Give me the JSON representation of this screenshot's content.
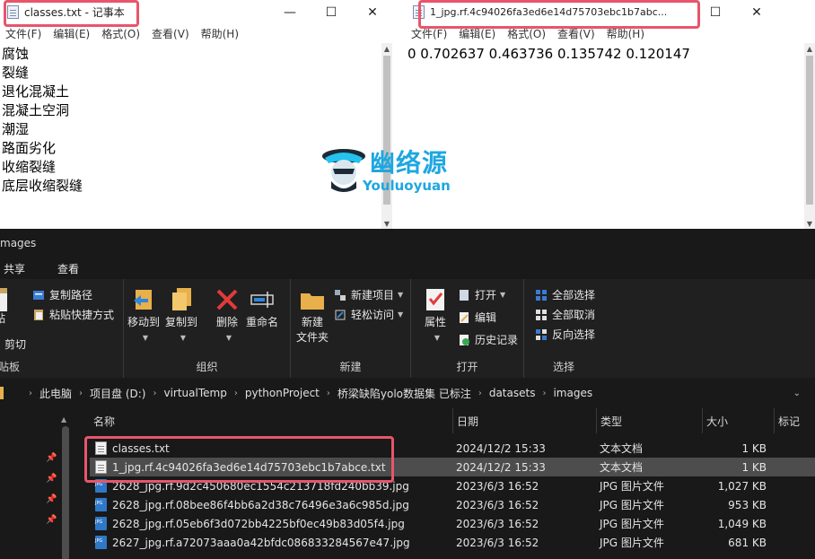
{
  "left_notepad": {
    "title": "classes.txt - 记事本",
    "menu": [
      "文件(F)",
      "编辑(E)",
      "格式(O)",
      "查看(V)",
      "帮助(H)"
    ],
    "lines": [
      "腐蚀",
      "裂缝",
      "退化混凝土",
      "混凝土空洞",
      "潮湿",
      "路面劣化",
      "收缩裂缝",
      "底层收缩裂缝"
    ]
  },
  "right_notepad": {
    "title": "1_jpg.rf.4c94026fa3ed6e14d75703ebc1b7abc...",
    "menu": [
      "文件(F)",
      "编辑(E)",
      "格式(O)",
      "查看(V)",
      "帮助(H)"
    ],
    "content": "0 0.702637 0.463736 0.135742 0.120147"
  },
  "window_controls": {
    "minimize": "—",
    "maximize": "☐",
    "close": "✕"
  },
  "watermark": {
    "cn": "幽络源",
    "en": "Youluoyuan"
  },
  "explorer": {
    "title": "mages",
    "tabs": [
      "共享",
      "查看"
    ],
    "ribbon": {
      "clipboard": {
        "copy_path": "复制路径",
        "paste_shortcut": "粘贴快捷方式",
        "paste": "贴",
        "cut": "剪切",
        "group": "贴板"
      },
      "organize": {
        "move_to": "移动到",
        "copy_to": "复制到",
        "delete": "删除",
        "rename": "重命名",
        "group": "组织"
      },
      "new": {
        "new_folder_1": "新建",
        "new_folder_2": "文件夹",
        "new_item": "新建项目",
        "easy_access": "轻松访问",
        "group": "新建"
      },
      "open": {
        "properties": "属性",
        "open": "打开",
        "edit": "编辑",
        "history": "历史记录",
        "group": "打开"
      },
      "select": {
        "select_all": "全部选择",
        "select_none": "全部取消",
        "invert": "反向选择",
        "group": "选择"
      }
    },
    "address": [
      "此电脑",
      "项目盘 (D:)",
      "virtualTemp",
      "pythonProject",
      "桥梁缺陷yolo数据集 已标注",
      "datasets",
      "images"
    ],
    "columns": [
      "名称",
      "日期",
      "类型",
      "大小",
      "标记"
    ],
    "files": [
      {
        "name": "classes.txt",
        "date": "2024/12/2 15:33",
        "type": "文本文档",
        "size": "1 KB",
        "icon": "txt"
      },
      {
        "name": "1_jpg.rf.4c94026fa3ed6e14d75703ebc1b7abce.txt",
        "date": "2024/12/2 15:33",
        "type": "文本文档",
        "size": "1 KB",
        "icon": "txt"
      },
      {
        "name": "2628_jpg.rf.9d2c450680ec1554c213718fd240bb39.jpg",
        "date": "2023/6/3 16:52",
        "type": "JPG 图片文件",
        "size": "1,027 KB",
        "icon": "jpg"
      },
      {
        "name": "2628_jpg.rf.08bee86f4bb6a2d38c76496e3a6c985d.jpg",
        "date": "2023/6/3 16:52",
        "type": "JPG 图片文件",
        "size": "953 KB",
        "icon": "jpg"
      },
      {
        "name": "2628_jpg.rf.05eb6f3d072bb4225bf0ec49b83d05f4.jpg",
        "date": "2023/6/3 16:52",
        "type": "JPG 图片文件",
        "size": "1,049 KB",
        "icon": "jpg"
      },
      {
        "name": "2627_jpg.rf.a72073aaa0a42bfdc086833284567e47.jpg",
        "date": "2023/6/3 16:52",
        "type": "JPG 图片文件",
        "size": "681 KB",
        "icon": "jpg"
      }
    ]
  },
  "colors": {
    "annotation_red": "#e8556b",
    "watermark_blue": "#1ea7e0",
    "explorer_bg": "#191919"
  }
}
